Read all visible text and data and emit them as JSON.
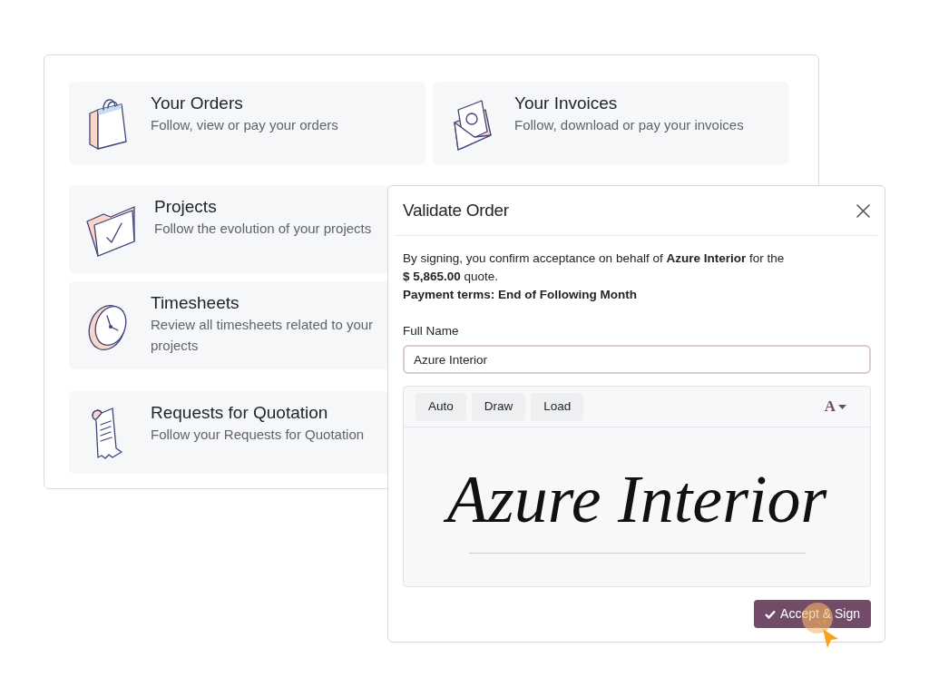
{
  "portal_tiles": [
    {
      "title": "Your Orders",
      "description": "Follow, view or pay your orders"
    },
    {
      "title": "Your Invoices",
      "description": "Follow, download or pay your invoices"
    },
    {
      "title": "Projects",
      "description": "Follow the evolution of your projects"
    },
    {
      "title": "Timesheets",
      "description": "Review all timesheets related to your projects"
    },
    {
      "title": "Requests for Quotation",
      "description": "Follow your Requests for Quotation"
    }
  ],
  "dialog": {
    "title": "Validate Order",
    "message": "By signing, you confirm acceptance on behalf of **Azure Interior** for the **$ 5,865.00** quote.",
    "payment_terms": "Payment terms: End of Following Month",
    "full_name": {
      "label": "Full Name",
      "value": "Azure Interior"
    },
    "signature": {
      "modes": [
        "Auto",
        "Draw",
        "Load"
      ],
      "font_button": "A",
      "signature_text": "Azure Interior"
    },
    "submit_button": "Accept & Sign"
  }
}
